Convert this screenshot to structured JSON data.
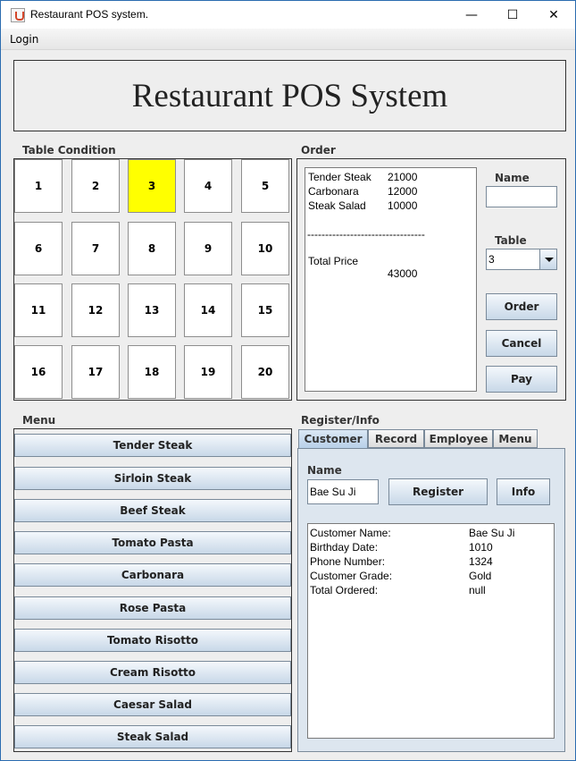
{
  "window": {
    "title": "Restaurant POS system.",
    "minimize": "—",
    "maximize": "☐",
    "close": "✕"
  },
  "menubar": {
    "login": "Login"
  },
  "banner": {
    "title": "Restaurant POS System"
  },
  "tables": {
    "label": "Table Condition",
    "numbers": [
      "1",
      "2",
      "3",
      "4",
      "5",
      "6",
      "7",
      "8",
      "9",
      "10",
      "11",
      "12",
      "13",
      "14",
      "15",
      "16",
      "17",
      "18",
      "19",
      "20"
    ],
    "selected": "3",
    "selected_color": "#ffff00"
  },
  "order": {
    "label": "Order",
    "lines": [
      {
        "name": "Tender Steak",
        "price": "21000"
      },
      {
        "name": "Carbonara",
        "price": "12000"
      },
      {
        "name": "Steak Salad",
        "price": "10000"
      }
    ],
    "separator": "---------------------------------",
    "total_label": "Total Price",
    "total_value": "43000",
    "name_label": "Name",
    "name_value": "",
    "table_label": "Table",
    "table_value": "3",
    "order_button": "Order",
    "cancel_button": "Cancel",
    "pay_button": "Pay"
  },
  "menu": {
    "label": "Menu",
    "items": [
      "Tender Steak",
      "Sirloin Steak",
      "Beef Steak",
      "Tomato Pasta",
      "Carbonara",
      "Rose Pasta",
      "Tomato Risotto",
      "Cream Risotto",
      "Caesar Salad",
      "Steak Salad"
    ]
  },
  "register": {
    "label": "Register/Info",
    "tabs": [
      "Customer",
      "Record",
      "Employee",
      "Menu"
    ],
    "active_tab": "Customer",
    "name_label": "Name",
    "name_value": "Bae Su Ji",
    "register_button": "Register",
    "info_button": "Info",
    "info": [
      {
        "key": "Customer Name:",
        "value": "Bae Su Ji"
      },
      {
        "key": "Birthday Date:",
        "value": "1010"
      },
      {
        "key": "Phone Number:",
        "value": "1324"
      },
      {
        "key": "Customer Grade:",
        "value": "Gold"
      },
      {
        "key": "Total Ordered:",
        "value": "null"
      }
    ]
  }
}
